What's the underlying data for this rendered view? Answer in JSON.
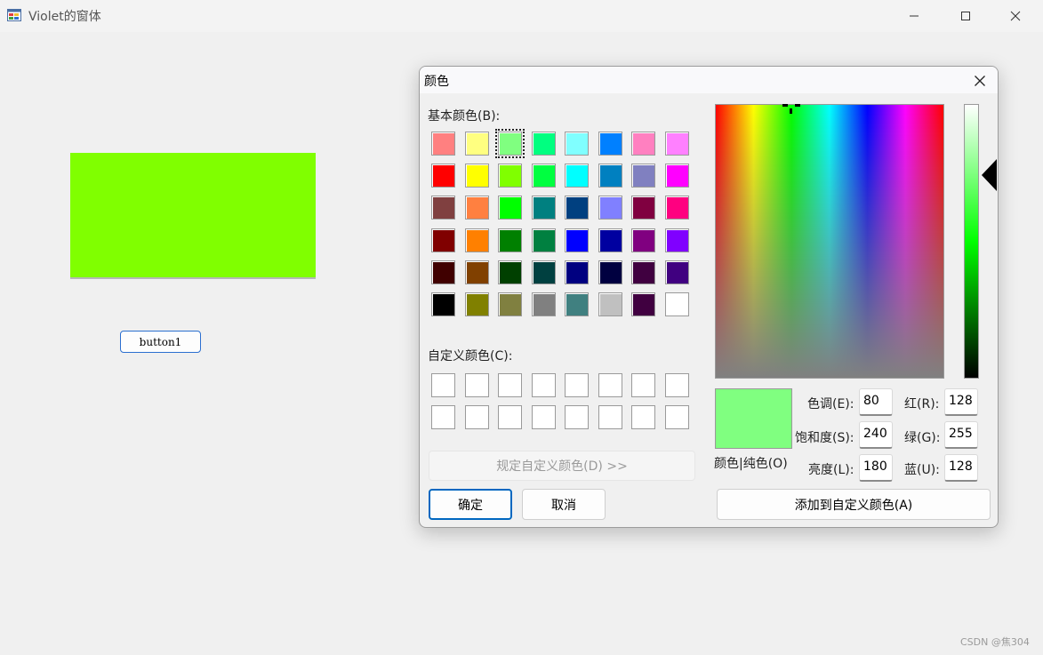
{
  "window": {
    "title": "Violet的窗体",
    "icon": "app-window-icon"
  },
  "main": {
    "panel_color": "#80ff00",
    "button1_label": "button1"
  },
  "watermark": "CSDN @焦304",
  "dialog": {
    "title": "颜色",
    "basic_colors_label": "基本颜色(B):",
    "basic_colors": [
      "#ff8080",
      "#ffff80",
      "#80ff80",
      "#00ff80",
      "#80ffff",
      "#0080ff",
      "#ff80c0",
      "#ff80ff",
      "#ff0000",
      "#ffff00",
      "#80ff00",
      "#00ff40",
      "#00ffff",
      "#0080c0",
      "#8080c0",
      "#ff00ff",
      "#804040",
      "#ff8040",
      "#00ff00",
      "#008080",
      "#004080",
      "#8080ff",
      "#800040",
      "#ff0080",
      "#800000",
      "#ff8000",
      "#008000",
      "#008040",
      "#0000ff",
      "#0000a0",
      "#800080",
      "#8000ff",
      "#400000",
      "#804000",
      "#004000",
      "#004040",
      "#000080",
      "#000040",
      "#400040",
      "#400080",
      "#000000",
      "#808000",
      "#808040",
      "#808080",
      "#408080",
      "#c0c0c0",
      "#400040",
      "#ffffff"
    ],
    "selected_basic_index": 2,
    "custom_colors_label": "自定义颜色(C):",
    "custom_colors": [
      "#ffffff",
      "#ffffff",
      "#ffffff",
      "#ffffff",
      "#ffffff",
      "#ffffff",
      "#ffffff",
      "#ffffff",
      "#ffffff",
      "#ffffff",
      "#ffffff",
      "#ffffff",
      "#ffffff",
      "#ffffff",
      "#ffffff",
      "#ffffff"
    ],
    "define_custom_label": "规定自定义颜色(D) >>",
    "ok_label": "确定",
    "cancel_label": "取消",
    "preview_color": "#80ff80",
    "preview_label": "颜色|纯色(O)",
    "hue_label": "色调(E):",
    "hue_value": "80",
    "sat_label": "饱和度(S):",
    "sat_value": "240",
    "lum_label": "亮度(L):",
    "lum_value": "180",
    "red_label": "红(R):",
    "red_value": "128",
    "green_label": "绿(G):",
    "green_value": "255",
    "blue_label": "蓝(U):",
    "blue_value": "128",
    "add_custom_label": "添加到自定义颜色(A)"
  }
}
